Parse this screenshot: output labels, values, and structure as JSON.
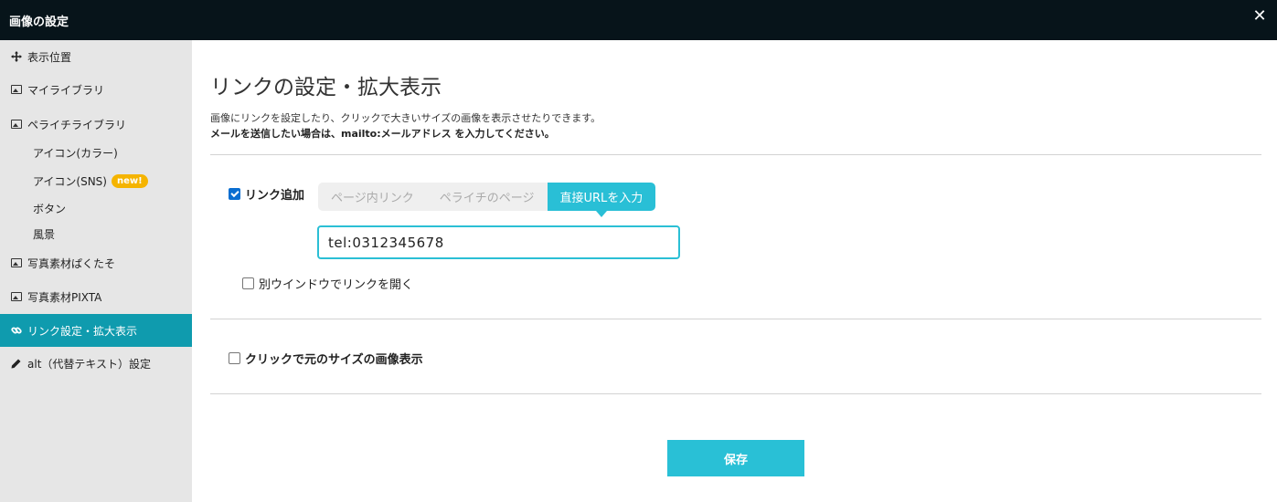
{
  "window": {
    "title": "画像の設定"
  },
  "sidebar": {
    "items": [
      {
        "label": "表示位置",
        "icon": "move-icon"
      },
      {
        "label": "マイライブラリ",
        "icon": "image-icon"
      },
      {
        "label": "ペライチライブラリ",
        "icon": "image-icon"
      },
      {
        "label": "アイコン(カラー)"
      },
      {
        "label": "アイコン(SNS)",
        "badge": "new!"
      },
      {
        "label": "ボタン"
      },
      {
        "label": "風景"
      },
      {
        "label": "写真素材ぱくたそ",
        "icon": "image-icon"
      },
      {
        "label": "写真素材PIXTA",
        "icon": "image-icon"
      },
      {
        "label": "リンク設定・拡大表示",
        "icon": "link-icon",
        "active": true
      },
      {
        "label": "alt（代替テキスト）設定",
        "icon": "pencil-icon"
      }
    ]
  },
  "main": {
    "heading": "リンクの設定・拡大表示",
    "description": "画像にリンクを設定したり、クリックで大きいサイズの画像を表示させたりできます。",
    "note": "メールを送信したい場合は、mailto:メールアドレス を入力してください。",
    "link_add_label": "リンク追加",
    "link_add_checked": true,
    "tabs": [
      {
        "label": "ページ内リンク",
        "active": false
      },
      {
        "label": "ペライチのページ",
        "active": false
      },
      {
        "label": "直接URLを入力",
        "active": true
      }
    ],
    "url_value": "tel:0312345678",
    "new_window_label": "別ウインドウでリンクを開く",
    "new_window_checked": false,
    "zoom_label": "クリックで元のサイズの画像表示",
    "zoom_checked": false,
    "save_label": "保存"
  },
  "colors": {
    "accent": "#29bfd6",
    "active_nav": "#0f9bae",
    "titlebar": "#07141a",
    "badge": "#f5b400"
  }
}
